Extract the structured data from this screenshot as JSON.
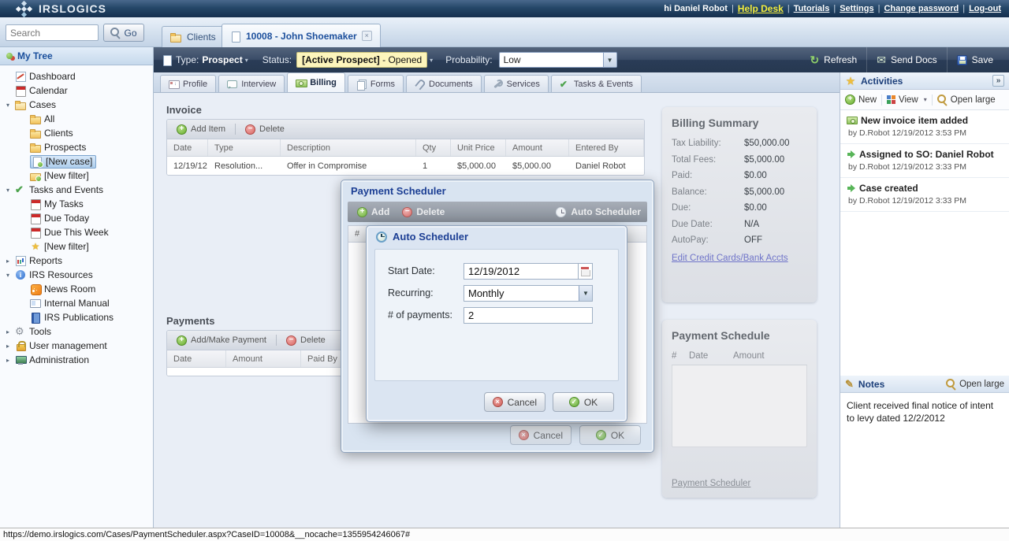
{
  "header": {
    "logo_text": "IRSLOGICS",
    "greeting": "hi Daniel Robot",
    "links": {
      "help_desk": "Help Desk",
      "tutorials": "Tutorials",
      "settings": "Settings",
      "change_password": "Change password",
      "logout": "Log-out"
    }
  },
  "colors": {
    "topbar_navy": "#254768",
    "help_desk_yellow": "#f3ec3d",
    "status_highlight": "#fdf5bc",
    "active_tab_blue": "#1c4f9c",
    "link_purple": "#6f74c9"
  },
  "search": {
    "placeholder": "Search",
    "go": "Go"
  },
  "tabs": {
    "clients": "Clients",
    "case": "10008 - John Shoemaker"
  },
  "case_toolbar": {
    "type_label": "Type:",
    "type_value": "Prospect",
    "status_label": "Status:",
    "status_value_bold": "[Active Prospect]",
    "status_value_rest": " - Opened",
    "probability_label": "Probability:",
    "probability_value": "Low",
    "refresh": "Refresh",
    "send_docs": "Send Docs",
    "save": "Save"
  },
  "sidebar": {
    "title": "My Tree",
    "items": [
      {
        "label": "Dashboard"
      },
      {
        "label": "Calendar"
      },
      {
        "label": "Cases"
      },
      {
        "label": "All"
      },
      {
        "label": "Clients"
      },
      {
        "label": "Prospects"
      },
      {
        "label": "[New case]"
      },
      {
        "label": "[New filter]"
      },
      {
        "label": "Tasks and Events"
      },
      {
        "label": "My Tasks"
      },
      {
        "label": "Due Today"
      },
      {
        "label": "Due This Week"
      },
      {
        "label": "[New filter]"
      },
      {
        "label": "Reports"
      },
      {
        "label": "IRS Resources"
      },
      {
        "label": "News Room"
      },
      {
        "label": "Internal Manual"
      },
      {
        "label": "IRS Publications"
      },
      {
        "label": "Tools"
      },
      {
        "label": "User management"
      },
      {
        "label": "Administration"
      }
    ]
  },
  "subtabs": {
    "items": [
      "Profile",
      "Interview",
      "Billing",
      "Forms",
      "Documents",
      "Services",
      "Tasks & Events"
    ]
  },
  "invoice": {
    "title": "Invoice",
    "add": "Add Item",
    "delete": "Delete",
    "columns": [
      "Date",
      "Type",
      "Description",
      "Qty",
      "Unit Price",
      "Amount",
      "Entered By"
    ],
    "rows": [
      [
        "12/19/12",
        "Resolution...",
        "Offer in Compromise",
        "1",
        "$5,000.00",
        "$5,000.00",
        "Daniel Robot"
      ]
    ]
  },
  "payments": {
    "title": "Payments",
    "add": "Add/Make Payment",
    "delete": "Delete",
    "columns": [
      "Date",
      "Amount",
      "Paid By"
    ]
  },
  "billing_summary": {
    "title": "Billing Summary",
    "rows": [
      {
        "label": "Tax Liability:",
        "value": "$50,000.00"
      },
      {
        "label": "Total Fees:",
        "value": "$5,000.00"
      },
      {
        "label": "Paid:",
        "value": "$0.00"
      },
      {
        "label": "Balance:",
        "value": "$5,000.00"
      },
      {
        "label": "Due:",
        "value": "$0.00"
      },
      {
        "label": "Due Date:",
        "value": "N/A"
      },
      {
        "label": "AutoPay:",
        "value": "OFF"
      }
    ],
    "link": "Edit Credit Cards/Bank Accts"
  },
  "payment_schedule": {
    "title": "Payment Schedule",
    "columns": [
      "#",
      "Date",
      "Amount"
    ],
    "link": "Payment Scheduler"
  },
  "activities": {
    "title": "Activities",
    "toolbar": {
      "new": "New",
      "view": "View",
      "open_large": "Open large"
    },
    "items": [
      {
        "title": "New invoice item added",
        "meta": "by D.Robot 12/19/2012 3:53 PM"
      },
      {
        "title": "Assigned to SO: Daniel Robot",
        "meta": "by D.Robot 12/19/2012 3:33 PM"
      },
      {
        "title": "Case created",
        "meta": "by D.Robot 12/19/2012 3:33 PM"
      }
    ]
  },
  "notes": {
    "title": "Notes",
    "open_large": "Open large",
    "text": "Client received final notice of intent to levy dated 12/2/2012"
  },
  "payment_scheduler_dialog": {
    "title": "Payment Scheduler",
    "add": "Add",
    "delete": "Delete",
    "auto_scheduler": "Auto Scheduler",
    "hash_column": "#",
    "cancel": "Cancel",
    "ok": "OK"
  },
  "auto_scheduler_dialog": {
    "title": "Auto Scheduler",
    "start_date_label": "Start Date:",
    "start_date_value": "12/19/2012",
    "recurring_label": "Recurring:",
    "recurring_value": "Monthly",
    "num_payments_label": "# of payments:",
    "num_payments_value": "2",
    "cancel": "Cancel",
    "ok": "OK"
  },
  "statusbar": {
    "url": "https://demo.irslogics.com/Cases/PaymentScheduler.aspx?CaseID=10008&__nocache=1355954246067#"
  }
}
